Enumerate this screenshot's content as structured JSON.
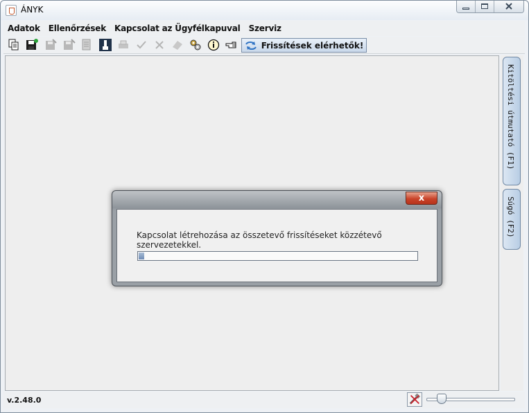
{
  "window": {
    "title": "ÁNYK"
  },
  "menubar": {
    "items": [
      "Adatok",
      "Ellenőrzések",
      "Kapcsolat az Ügyfélkapuval",
      "Szerviz"
    ]
  },
  "toolbar": {
    "update_label": "Frissítések elérhetők!",
    "icons": [
      "copy-icon",
      "save-icon",
      "save-disabled-icon",
      "save-as-disabled-icon",
      "archive-disabled-icon",
      "key-icon",
      "print-disabled-icon",
      "check-disabled-icon",
      "cross-disabled-icon",
      "signature-disabled-icon",
      "gears-icon",
      "info-icon",
      "pointing-hand-icon"
    ]
  },
  "side_tabs": [
    "Kitöltési útmutató (F1)",
    "Súgó (F2)"
  ],
  "dialog": {
    "close_glyph": "x",
    "message": "Kapcsolat létrehozása az összetevő frissítéseket közzétevő szervezetekkel.",
    "progress": 0.02
  },
  "status": {
    "version": "v.2.48.0",
    "zoom_level": 0.17
  }
}
